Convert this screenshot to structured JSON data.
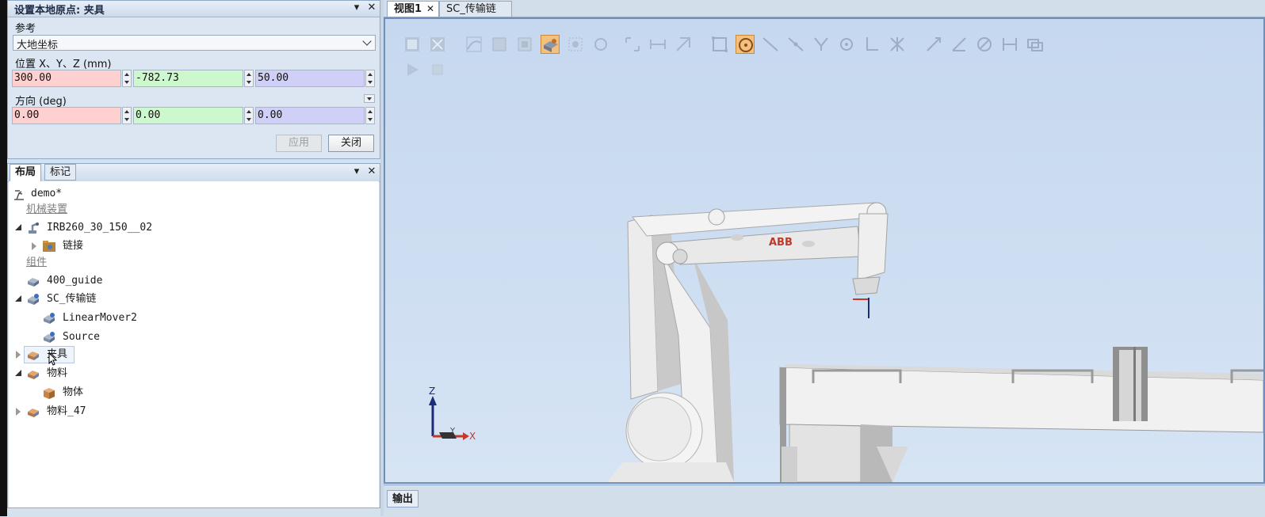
{
  "origin_panel": {
    "title": "设置本地原点: 夹具",
    "reference_label": "参考",
    "reference_value": "大地坐标",
    "position_label": "位置 X、Y、Z (mm)",
    "position": {
      "x": "300.00",
      "y": "-782.73",
      "z": "50.00"
    },
    "orientation_label": "方向 (deg)",
    "orientation": {
      "x": "0.00",
      "y": "0.00",
      "z": "0.00"
    },
    "apply_label": "应用",
    "close_label": "关闭",
    "pin_glyph": "▾",
    "close_glyph": "✕"
  },
  "layout_panel": {
    "tabs": [
      "布局",
      "标记"
    ],
    "pin_glyph": "▾",
    "close_glyph": "✕",
    "tree": {
      "root": "demo*",
      "cat_mechanisms": "机械装置",
      "robot": "IRB260_30_150__02",
      "links": "链接",
      "cat_components": "组件",
      "guide": "400_guide",
      "conveyor": "SC_传输链",
      "mover": "LinearMover2",
      "source": "Source",
      "gripper": "夹具",
      "material": "物料",
      "body": "物体",
      "material47": "物料_47"
    }
  },
  "view_tabs": [
    "视图1",
    "SC_传输链"
  ],
  "view_tab_close": "✕",
  "axis": {
    "z": "Z",
    "y": "Y",
    "x": "X"
  },
  "robot_logo": "ABB",
  "output_tab": "输出",
  "colors": {
    "x_field": "#ffd0d0",
    "y_field": "#cdf7cd",
    "z_field": "#cfcff7",
    "accent": "#f08a24"
  }
}
